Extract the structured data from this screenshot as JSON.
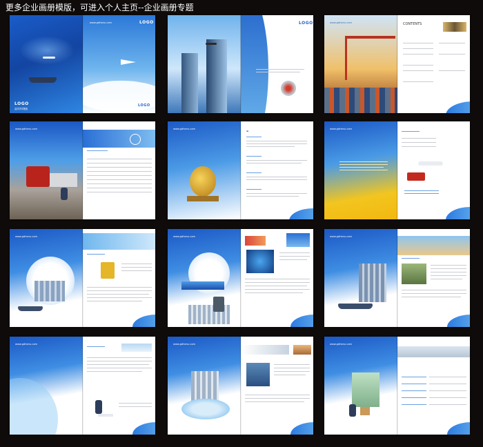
{
  "banner": {
    "text": "更多企业画册模版，可进入个人主页--企业画册专题"
  },
  "brand": {
    "url": "www.gdhenu.com",
    "logo": "LOGO",
    "company": "高洋华宇物流",
    "contents_title": "CONTENTS"
  },
  "colors": {
    "background": "#0e0b0a",
    "blue_deep": "#1849a8",
    "blue_mid": "#2f7be0",
    "blue_light": "#7fc3f2",
    "yellow": "#f2c21b",
    "page": "#ffffff"
  },
  "spreads": [
    {
      "id": "cover",
      "left_theme": "cover-blue",
      "right_theme": "sky-plane"
    },
    {
      "id": "skyscraper",
      "left_theme": "sky-tower",
      "right_theme": "wave-gears"
    },
    {
      "id": "port-contents",
      "left_theme": "port-crane",
      "right_theme": "contents"
    },
    {
      "id": "truck-table",
      "left_theme": "truck",
      "right_theme": "table"
    },
    {
      "id": "kylin-text",
      "left_theme": "kylin",
      "right_theme": "text"
    },
    {
      "id": "yellow-plane",
      "left_theme": "yellow-text",
      "right_theme": "plane-truck"
    },
    {
      "id": "city-forklift",
      "left_theme": "city-river",
      "right_theme": "forklift"
    },
    {
      "id": "pedestal-tech",
      "left_theme": "pedestal",
      "right_theme": "tech"
    },
    {
      "id": "city-ship-sky",
      "left_theme": "city-ship",
      "right_theme": "cityscape"
    },
    {
      "id": "white-text",
      "left_theme": "wave-only",
      "right_theme": "courier"
    },
    {
      "id": "train-man",
      "left_theme": "train-globe",
      "right_theme": "worker"
    },
    {
      "id": "wave-container",
      "left_theme": "wave-only",
      "right_theme": "container"
    }
  ]
}
